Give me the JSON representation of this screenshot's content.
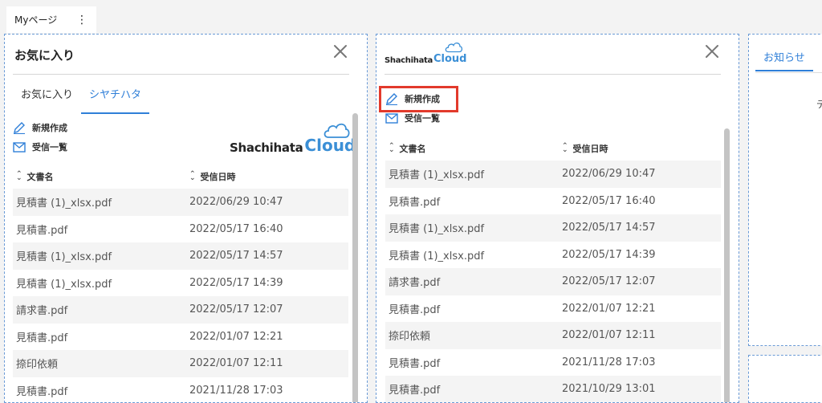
{
  "top_tab": {
    "label": "Myページ",
    "menu_icon": "⋮"
  },
  "favorites_panel": {
    "title": "お気に入り",
    "close_icon": "close-icon",
    "tabs": [
      {
        "label": "お気に入り",
        "active": false
      },
      {
        "label": "シヤチハタ",
        "active": true
      }
    ],
    "actions": {
      "new": "新規作成",
      "inbox": "受信一覧"
    },
    "logo": {
      "word1": "Shachihata",
      "word2": "Cloud"
    },
    "table": {
      "col_name": "文書名",
      "col_date": "受信日時",
      "rows": [
        {
          "name": "見積書 (1)_xlsx.pdf",
          "date": "2022/06/29 10:47"
        },
        {
          "name": "見積書.pdf",
          "date": "2022/05/17 16:40"
        },
        {
          "name": "見積書 (1)_xlsx.pdf",
          "date": "2022/05/17 14:57"
        },
        {
          "name": "見積書 (1)_xlsx.pdf",
          "date": "2022/05/17 14:39"
        },
        {
          "name": "請求書.pdf",
          "date": "2022/05/17 12:07"
        },
        {
          "name": "見積書.pdf",
          "date": "2022/01/07 12:21"
        },
        {
          "name": "捺印依頼",
          "date": "2022/01/07 12:11"
        },
        {
          "name": "見積書.pdf",
          "date": "2021/11/28 17:03"
        }
      ]
    }
  },
  "cloud_panel": {
    "logo": {
      "word1": "Shachihata",
      "word2": "Cloud"
    },
    "close_icon": "close-icon",
    "actions": {
      "new": "新規作成",
      "inbox": "受信一覧"
    },
    "highlight_color": "#e23a2c",
    "table": {
      "col_name": "文書名",
      "col_date": "受信日時",
      "rows": [
        {
          "name": "見積書 (1)_xlsx.pdf",
          "date": "2022/06/29 10:47"
        },
        {
          "name": "見積書.pdf",
          "date": "2022/05/17 16:40"
        },
        {
          "name": "見積書 (1)_xlsx.pdf",
          "date": "2022/05/17 14:57"
        },
        {
          "name": "見積書 (1)_xlsx.pdf",
          "date": "2022/05/17 14:39"
        },
        {
          "name": "請求書.pdf",
          "date": "2022/05/17 12:07"
        },
        {
          "name": "見積書.pdf",
          "date": "2022/01/07 12:21"
        },
        {
          "name": "捺印依頼",
          "date": "2022/01/07 12:11"
        },
        {
          "name": "見積書.pdf",
          "date": "2021/11/28 17:03"
        },
        {
          "name": "見積書.pdf",
          "date": "2021/10/29 13:01"
        }
      ]
    }
  },
  "notice_panel": {
    "tab": "お知らせ",
    "text": "デ"
  },
  "colors": {
    "accent": "#2f7fd8",
    "brand_cloud": "#3b8fd6",
    "panel_border": "#6a9ad6"
  }
}
